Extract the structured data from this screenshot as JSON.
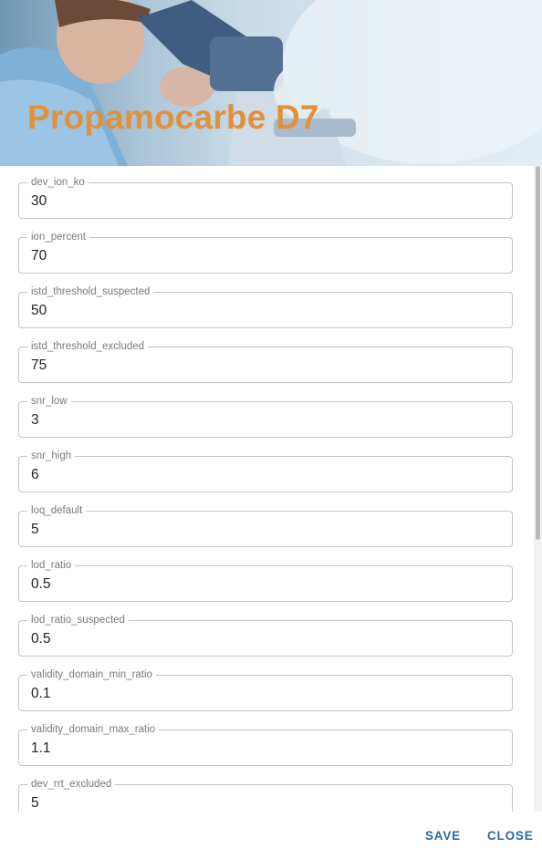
{
  "dialog": {
    "title": "Propamocarbe D7",
    "fields": [
      {
        "label": "dev_ion_ko",
        "value": "30"
      },
      {
        "label": "ion_percent",
        "value": "70"
      },
      {
        "label": "istd_threshold_suspected",
        "value": "50"
      },
      {
        "label": "istd_threshold_excluded",
        "value": "75"
      },
      {
        "label": "snr_low",
        "value": "3"
      },
      {
        "label": "snr_high",
        "value": "6"
      },
      {
        "label": "loq_default",
        "value": "5"
      },
      {
        "label": "lod_ratio",
        "value": "0.5"
      },
      {
        "label": "lod_ratio_suspected",
        "value": "0.5"
      },
      {
        "label": "validity_domain_min_ratio",
        "value": "0.1"
      },
      {
        "label": "validity_domain_max_ratio",
        "value": "1.1"
      },
      {
        "label": "dev_rrt_excluded",
        "value": "5"
      }
    ],
    "actions": {
      "save_label": "SAVE",
      "close_label": "CLOSE"
    }
  },
  "colors": {
    "title": "#e0913b",
    "button": "#2c6aa0",
    "field_border": "#c4c4c4"
  }
}
